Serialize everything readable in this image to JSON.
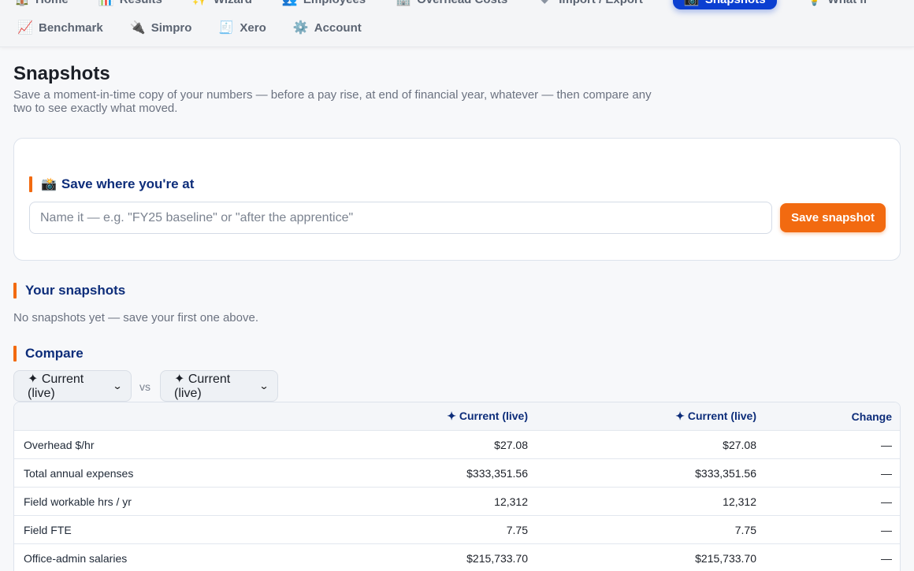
{
  "nav": {
    "row1": [
      {
        "icon": "🏠",
        "label": "Home"
      },
      {
        "icon": "📊",
        "label": "Results"
      },
      {
        "icon": "✨",
        "label": "Wizard"
      },
      {
        "icon": "👥",
        "label": "Employees"
      },
      {
        "icon": "🏢",
        "label": "Overhead Costs"
      },
      {
        "icon": "⬇",
        "label": "Import / Export"
      },
      {
        "icon": "📸",
        "label": "Snapshots"
      },
      {
        "icon": "💡",
        "label": "What if"
      }
    ],
    "row2": [
      {
        "icon": "📈",
        "label": "Benchmark"
      },
      {
        "icon": "🔌",
        "label": "Simpro"
      },
      {
        "icon": "🧾",
        "label": "Xero"
      },
      {
        "icon": "⚙️",
        "label": "Account"
      }
    ]
  },
  "page": {
    "title": "Snapshots",
    "subtitle": "Save a moment-in-time copy of your numbers — before a pay rise, at end of financial year, whatever — then compare any two to see exactly what moved."
  },
  "save": {
    "emoji": "📸",
    "heading": "Save where you're at",
    "placeholder": "Name it — e.g. \"FY25 baseline\" or \"after the apprentice\"",
    "button": "Save snapshot"
  },
  "snapshots": {
    "heading": "Your snapshots",
    "empty": "No snapshots yet — save your first one above."
  },
  "compare": {
    "heading": "Compare",
    "left": "✦ Current (live)",
    "vs": "vs",
    "right": "✦ Current (live)",
    "columns": [
      "",
      "✦ Current (live)",
      "✦ Current (live)",
      "Change"
    ],
    "rows": [
      [
        "Overhead $/hr",
        "$27.08",
        "$27.08",
        "—"
      ],
      [
        "Total annual expenses",
        "$333,351.56",
        "$333,351.56",
        "—"
      ],
      [
        "Field workable hrs / yr",
        "12,312",
        "12,312",
        "—"
      ],
      [
        "Field FTE",
        "7.75",
        "7.75",
        "—"
      ],
      [
        "Office-admin salaries",
        "$215,733.70",
        "$215,733.70",
        "—"
      ]
    ]
  }
}
